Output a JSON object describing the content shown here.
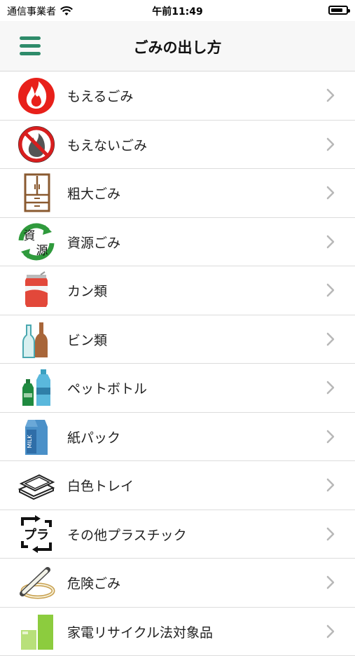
{
  "status_bar": {
    "carrier": "通信事業者",
    "time": "午前11:49",
    "battery_level": 0.8,
    "wifi_icon": "wifi-icon",
    "battery_icon": "battery-icon"
  },
  "nav": {
    "title": "ごみの出し方",
    "menu_icon": "hamburger-menu-icon",
    "accent_color": "#2e8b6a"
  },
  "items": [
    {
      "label": "もえるごみ",
      "icon": "flame-icon"
    },
    {
      "label": "もえないごみ",
      "icon": "no-burn-icon"
    },
    {
      "label": "粗大ごみ",
      "icon": "cabinet-icon"
    },
    {
      "label": "資源ごみ",
      "icon": "recycle-resources-icon",
      "icon_text_1": "資",
      "icon_text_2": "源"
    },
    {
      "label": "カン類",
      "icon": "can-icon"
    },
    {
      "label": "ビン類",
      "icon": "bottles-icon"
    },
    {
      "label": "ペットボトル",
      "icon": "pet-bottle-icon"
    },
    {
      "label": "紙パック",
      "icon": "milk-carton-icon",
      "icon_text": "MILK"
    },
    {
      "label": "白色トレイ",
      "icon": "food-tray-icon"
    },
    {
      "label": "その他プラスチック",
      "icon": "plastic-mark-icon",
      "icon_text": "プラ"
    },
    {
      "label": "危険ごみ",
      "icon": "fluorescent-tube-icon"
    },
    {
      "label": "家電リサイクル法対象品",
      "icon": "appliance-icon"
    }
  ]
}
